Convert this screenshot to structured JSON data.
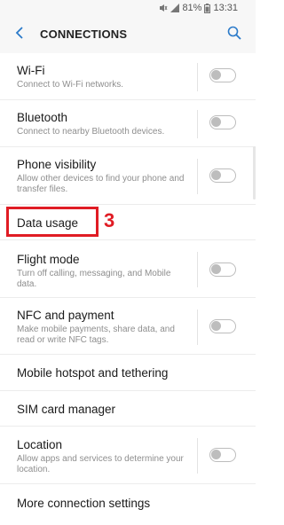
{
  "status_bar": {
    "battery": "81%",
    "time": "13:31"
  },
  "app_bar": {
    "title": "CONNECTIONS",
    "back_icon": "back-chevron-icon",
    "search_icon": "search-icon"
  },
  "settings": [
    {
      "title": "Wi-Fi",
      "subtitle": "Connect to Wi-Fi networks.",
      "toggle": false
    },
    {
      "title": "Bluetooth",
      "subtitle": "Connect to nearby Bluetooth devices.",
      "toggle": false
    },
    {
      "title": "Phone visibility",
      "subtitle": "Allow other devices to find your phone and transfer files.",
      "toggle": false
    },
    {
      "title": "Data usage",
      "subtitle": ""
    },
    {
      "title": "Flight mode",
      "subtitle": "Turn off calling, messaging, and Mobile data.",
      "toggle": false
    },
    {
      "title": "NFC and payment",
      "subtitle": "Make mobile payments, share data, and read or write NFC tags.",
      "toggle": false
    },
    {
      "title": "Mobile hotspot and tethering",
      "subtitle": ""
    },
    {
      "title": "SIM card manager",
      "subtitle": ""
    },
    {
      "title": "Location",
      "subtitle": "Allow apps and services to determine your location.",
      "toggle": false
    },
    {
      "title": "More connection settings",
      "subtitle": ""
    }
  ],
  "annotation": {
    "step": "3",
    "color": "#e01c24"
  }
}
